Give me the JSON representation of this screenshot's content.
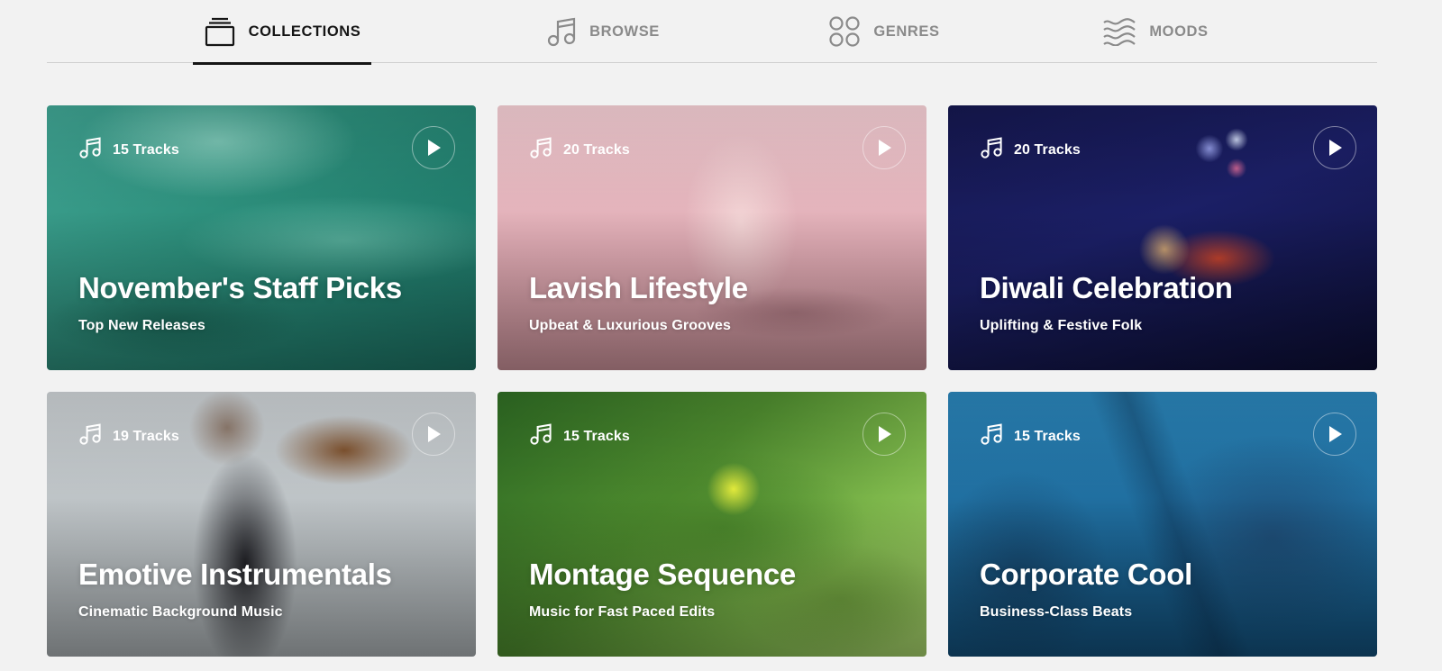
{
  "tabs": [
    {
      "label": "COLLECTIONS",
      "icon": "collections-icon",
      "active": true
    },
    {
      "label": "BROWSE",
      "icon": "music-note-icon",
      "active": false
    },
    {
      "label": "GENRES",
      "icon": "grid-circles-icon",
      "active": false
    },
    {
      "label": "MOODS",
      "icon": "waves-icon",
      "active": false
    }
  ],
  "collections": [
    {
      "tracks": "15 Tracks",
      "title": "November's Staff Picks",
      "subtitle": "Top New Releases"
    },
    {
      "tracks": "20 Tracks",
      "title": "Lavish Lifestyle",
      "subtitle": "Upbeat & Luxurious Grooves"
    },
    {
      "tracks": "20 Tracks",
      "title": "Diwali Celebration",
      "subtitle": "Uplifting & Festive Folk"
    },
    {
      "tracks": "19 Tracks",
      "title": "Emotive Instrumentals",
      "subtitle": "Cinematic Background Music"
    },
    {
      "tracks": "15 Tracks",
      "title": "Montage Sequence",
      "subtitle": "Music for Fast Paced Edits"
    },
    {
      "tracks": "15 Tracks",
      "title": "Corporate Cool",
      "subtitle": "Business-Class Beats"
    }
  ],
  "colors": {
    "background": "#f2f2f2",
    "active_tab": "#151515",
    "inactive_tab": "#8a8a8a"
  }
}
